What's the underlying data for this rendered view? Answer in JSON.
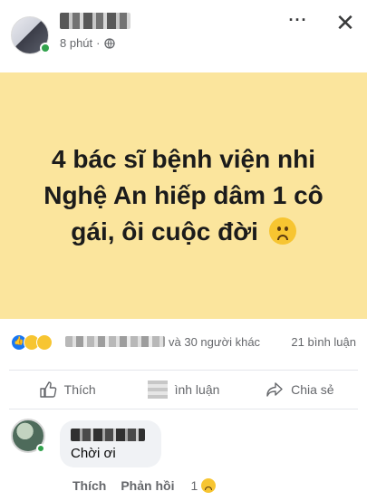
{
  "header": {
    "time": "8 phút",
    "more_icon": "more-horizontal-icon",
    "close_icon": "close-icon",
    "privacy_icon": "globe-icon"
  },
  "post": {
    "text": "4 bác sĩ bệnh viện nhi Nghệ An hiếp dâm 1 cô gái, ôi cuộc đời",
    "background_color": "#fbe59d"
  },
  "stats": {
    "others_text": "và 30 người khác",
    "comments_text": "21 bình luận"
  },
  "actions": {
    "like_label": "Thích",
    "comment_label": "ình luận",
    "share_label": "Chia sẻ"
  },
  "comment": {
    "text": "Chời ơi",
    "like_label": "Thích",
    "reply_label": "Phản hồi",
    "reaction_count": "1"
  },
  "colors": {
    "accent": "#1877f2",
    "online": "#31a24c",
    "secondary_text": "#65676b"
  }
}
